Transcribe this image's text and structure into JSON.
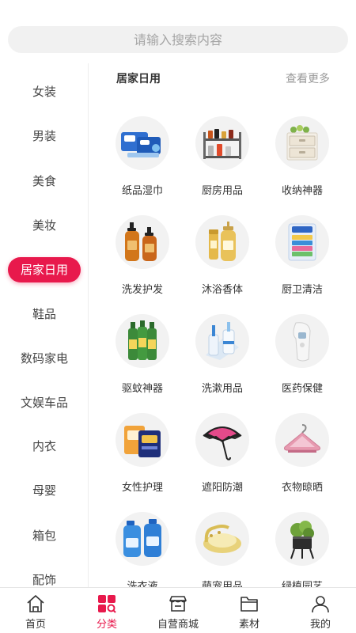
{
  "search": {
    "placeholder": "请输入搜索内容"
  },
  "sidebar": {
    "items": [
      {
        "label": "女装"
      },
      {
        "label": "男装"
      },
      {
        "label": "美食"
      },
      {
        "label": "美妆"
      },
      {
        "label": "居家日用",
        "active": true
      },
      {
        "label": "鞋品"
      },
      {
        "label": "数码家电"
      },
      {
        "label": "文娱车品"
      },
      {
        "label": "内衣"
      },
      {
        "label": "母婴"
      },
      {
        "label": "箱包"
      },
      {
        "label": "配饰"
      }
    ]
  },
  "content": {
    "title": "居家日用",
    "more": "查看更多",
    "categories": [
      {
        "label": "纸品湿巾",
        "icon": "tissue-pack-icon"
      },
      {
        "label": "厨房用品",
        "icon": "kitchen-rack-icon"
      },
      {
        "label": "收纳神器",
        "icon": "storage-drawer-icon"
      },
      {
        "label": "洗发护发",
        "icon": "shampoo-bottle-icon"
      },
      {
        "label": "沐浴香体",
        "icon": "body-wash-icon"
      },
      {
        "label": "厨卫清洁",
        "icon": "sponge-icon"
      },
      {
        "label": "驱蚊神器",
        "icon": "mosquito-repellent-icon"
      },
      {
        "label": "洗漱用品",
        "icon": "toothbrush-cup-icon"
      },
      {
        "label": "医药保健",
        "icon": "thermometer-icon"
      },
      {
        "label": "女性护理",
        "icon": "sanitary-pad-icon"
      },
      {
        "label": "遮阳防潮",
        "icon": "umbrella-icon"
      },
      {
        "label": "衣物晾晒",
        "icon": "hanger-icon"
      },
      {
        "label": "洗衣液",
        "icon": "laundry-detergent-icon"
      },
      {
        "label": "萌宠用品",
        "icon": "pet-bed-icon"
      },
      {
        "label": "绿植园艺",
        "icon": "potted-plant-icon"
      }
    ]
  },
  "tabbar": {
    "items": [
      {
        "label": "首页",
        "icon": "home-icon"
      },
      {
        "label": "分类",
        "icon": "category-icon",
        "active": true
      },
      {
        "label": "自营商城",
        "icon": "store-icon"
      },
      {
        "label": "素材",
        "icon": "folder-icon"
      },
      {
        "label": "我的",
        "icon": "user-icon"
      }
    ]
  },
  "colors": {
    "accent": "#e8194c",
    "circle_bg": "#f2f2f2",
    "search_bg": "#f1f1f1"
  }
}
